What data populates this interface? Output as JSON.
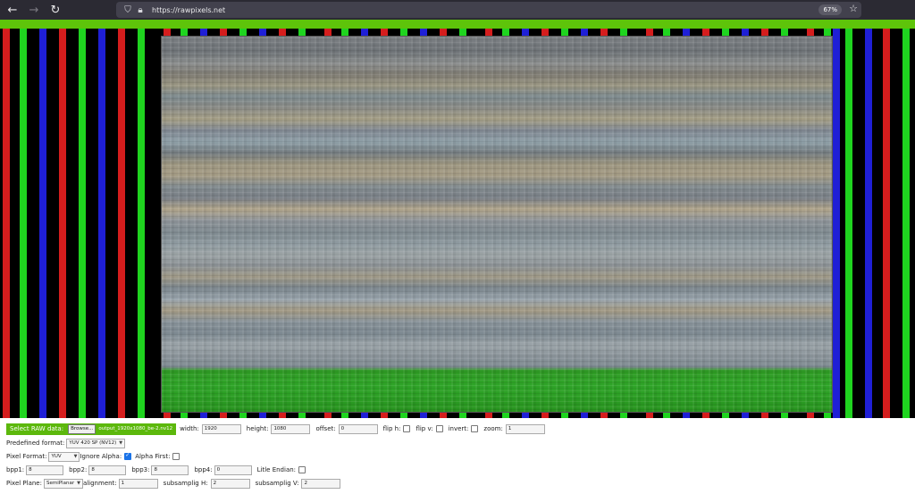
{
  "browser": {
    "url": "https://rawpixels.net",
    "zoom": "67%"
  },
  "controls": {
    "select_raw_label": "Select RAW data:",
    "browse_label": "Browse...",
    "file_name": "output_1920x1080_be-2.nv12",
    "width_label": "width:",
    "width_value": "1920",
    "height_label": "height:",
    "height_value": "1080",
    "offset_label": "offset:",
    "offset_value": "0",
    "flip_h_label": "flip h:",
    "flip_v_label": "flip v:",
    "invert_label": "invert:",
    "zoom_label": "zoom:",
    "zoom_value": "1",
    "predefined_label": "Predefined format:",
    "predefined_value": "YUV 420 SP (NV12)",
    "pixel_format_label": "Pixel Format:",
    "pixel_format_value": "YUV",
    "ignore_alpha_label": "Ignore Alpha:",
    "ignore_alpha_checked": true,
    "alpha_first_label": "Alpha First:",
    "bpp1_label": "bpp1:",
    "bpp1_value": "8",
    "bpp2_label": "bpp2:",
    "bpp2_value": "8",
    "bpp3_label": "bpp3:",
    "bpp3_value": "8",
    "bpp4_label": "bpp4:",
    "bpp4_value": "0",
    "little_endian_label": "Litle Endian:",
    "pixel_plane_label": "Pixel Plane:",
    "pixel_plane_value": "SemiPlanar",
    "alignment_label": "alignment:",
    "alignment_value": "1",
    "subsamp_h_label": "subsamplig H:",
    "subsamp_h_value": "2",
    "subsamp_v_label": "subsamplig V:",
    "subsamp_v_value": "2"
  }
}
